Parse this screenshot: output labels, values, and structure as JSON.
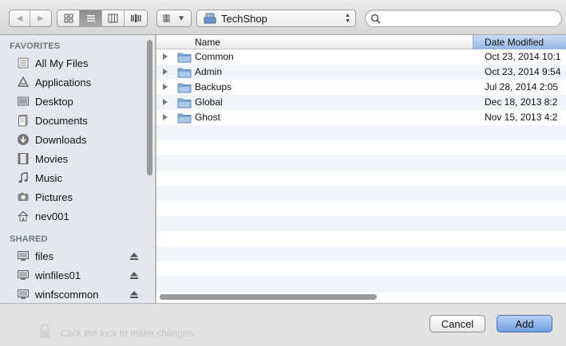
{
  "toolbar": {
    "location_name": "TechShop",
    "search_placeholder": ""
  },
  "sidebar": {
    "favorites_header": "FAVORITES",
    "favorites": [
      {
        "label": "All My Files",
        "icon": "all-files-icon"
      },
      {
        "label": "Applications",
        "icon": "applications-icon"
      },
      {
        "label": "Desktop",
        "icon": "desktop-icon"
      },
      {
        "label": "Documents",
        "icon": "documents-icon"
      },
      {
        "label": "Downloads",
        "icon": "downloads-icon"
      },
      {
        "label": "Movies",
        "icon": "movies-icon"
      },
      {
        "label": "Music",
        "icon": "music-icon"
      },
      {
        "label": "Pictures",
        "icon": "pictures-icon"
      },
      {
        "label": "nev001",
        "icon": "home-icon"
      }
    ],
    "shared_header": "SHARED",
    "shared": [
      {
        "label": "files",
        "icon": "server-icon"
      },
      {
        "label": "winfiles01",
        "icon": "server-icon"
      },
      {
        "label": "winfscommon",
        "icon": "server-icon"
      }
    ]
  },
  "list": {
    "columns": {
      "name": "Name",
      "date": "Date Modified"
    },
    "rows": [
      {
        "name": "Common",
        "date": "Oct 23, 2014 10:1"
      },
      {
        "name": "Admin",
        "date": "Oct 23, 2014 9:54"
      },
      {
        "name": "Backups",
        "date": "Jul 28, 2014 2:05"
      },
      {
        "name": "Global",
        "date": "Dec 18, 2013 8:2"
      },
      {
        "name": "Ghost",
        "date": "Nov 15, 2013 4:2"
      }
    ]
  },
  "buttons": {
    "cancel": "Cancel",
    "add": "Add"
  },
  "background_text": "Click the lock to make changes.",
  "colors": {
    "accent": "#6d9ee0",
    "sidebar_bg": "#e4e8ee",
    "selected_column": "#94b6e4"
  }
}
